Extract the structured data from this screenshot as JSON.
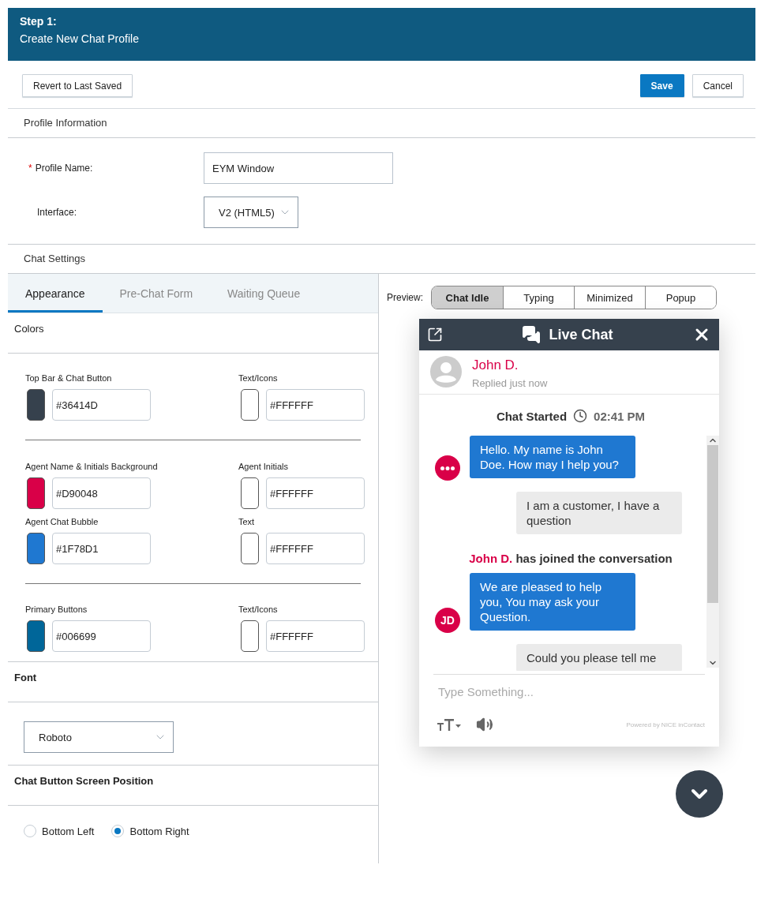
{
  "header": {
    "step": "Step 1:",
    "title": "Create New Chat Profile"
  },
  "actions": {
    "revert": "Revert to Last Saved",
    "save": "Save",
    "cancel": "Cancel"
  },
  "profile_information": {
    "heading": "Profile Information",
    "profile_name": {
      "required_mark": "*",
      "label": "Profile Name:",
      "value": "EYM Window"
    },
    "interface": {
      "label": "Interface:",
      "value": "V2 (HTML5)"
    }
  },
  "chat_settings": {
    "heading": "Chat Settings"
  },
  "tabs": [
    {
      "label": "Appearance",
      "selected": true
    },
    {
      "label": "Pre-Chat Form",
      "selected": false
    },
    {
      "label": "Waiting Queue",
      "selected": false
    }
  ],
  "colors": {
    "heading": "Colors",
    "groups": [
      [
        {
          "left": {
            "label": "Top Bar & Chat Button",
            "color": "#36414d",
            "value": "#36414D"
          },
          "right": {
            "label": "Text/Icons",
            "color": "#ffffff",
            "value": "#FFFFFF"
          }
        }
      ],
      [
        {
          "left": {
            "label": "Agent Name & Initials Background",
            "color": "#d90048",
            "value": "#D90048"
          },
          "right": {
            "label": "Agent Initials",
            "color": "#ffffff",
            "value": "#FFFFFF"
          }
        },
        {
          "left": {
            "label": "Agent Chat Bubble",
            "color": "#1f78d1",
            "value": "#1F78D1"
          },
          "right": {
            "label": "Text",
            "color": "#ffffff",
            "value": "#FFFFFF"
          }
        }
      ],
      [
        {
          "left": {
            "label": "Primary Buttons",
            "color": "#006699",
            "value": "#006699"
          },
          "right": {
            "label": "Text/Icons",
            "color": "#ffffff",
            "value": "#FFFFFF"
          }
        }
      ]
    ]
  },
  "font": {
    "heading": "Font",
    "value": "Roboto"
  },
  "position": {
    "heading": "Chat Button Screen Position",
    "options": [
      {
        "label": "Bottom Left",
        "selected": false
      },
      {
        "label": "Bottom Right",
        "selected": true
      }
    ]
  },
  "preview": {
    "label": "Preview:",
    "modes": [
      {
        "label": "Chat Idle",
        "selected": true
      },
      {
        "label": "Typing",
        "selected": false
      },
      {
        "label": "Minimized",
        "selected": false
      },
      {
        "label": "Popup",
        "selected": false
      }
    ]
  },
  "chat": {
    "title": "Live Chat",
    "agent_name": "John D.",
    "agent_status": "Replied just now",
    "messages": [
      {
        "kind": "started",
        "text": "Chat Started",
        "time": "02:41 PM"
      },
      {
        "kind": "agent",
        "avatar": {
          "kind": "typing"
        },
        "text": "Hello. My name is John Doe. How may I help you?"
      },
      {
        "kind": "customer",
        "text": "I am a customer, I have a question"
      },
      {
        "kind": "joined",
        "name": "John D.",
        "text": "has joined the conversation"
      },
      {
        "kind": "agent",
        "avatar": {
          "kind": "initials",
          "text": "JD"
        },
        "text": "We are pleased to help you, You may ask your Question."
      },
      {
        "kind": "customer",
        "text": "Could you please tell me"
      }
    ],
    "input_placeholder": "Type Something...",
    "powered_by": "Powered by NICE inContact"
  }
}
